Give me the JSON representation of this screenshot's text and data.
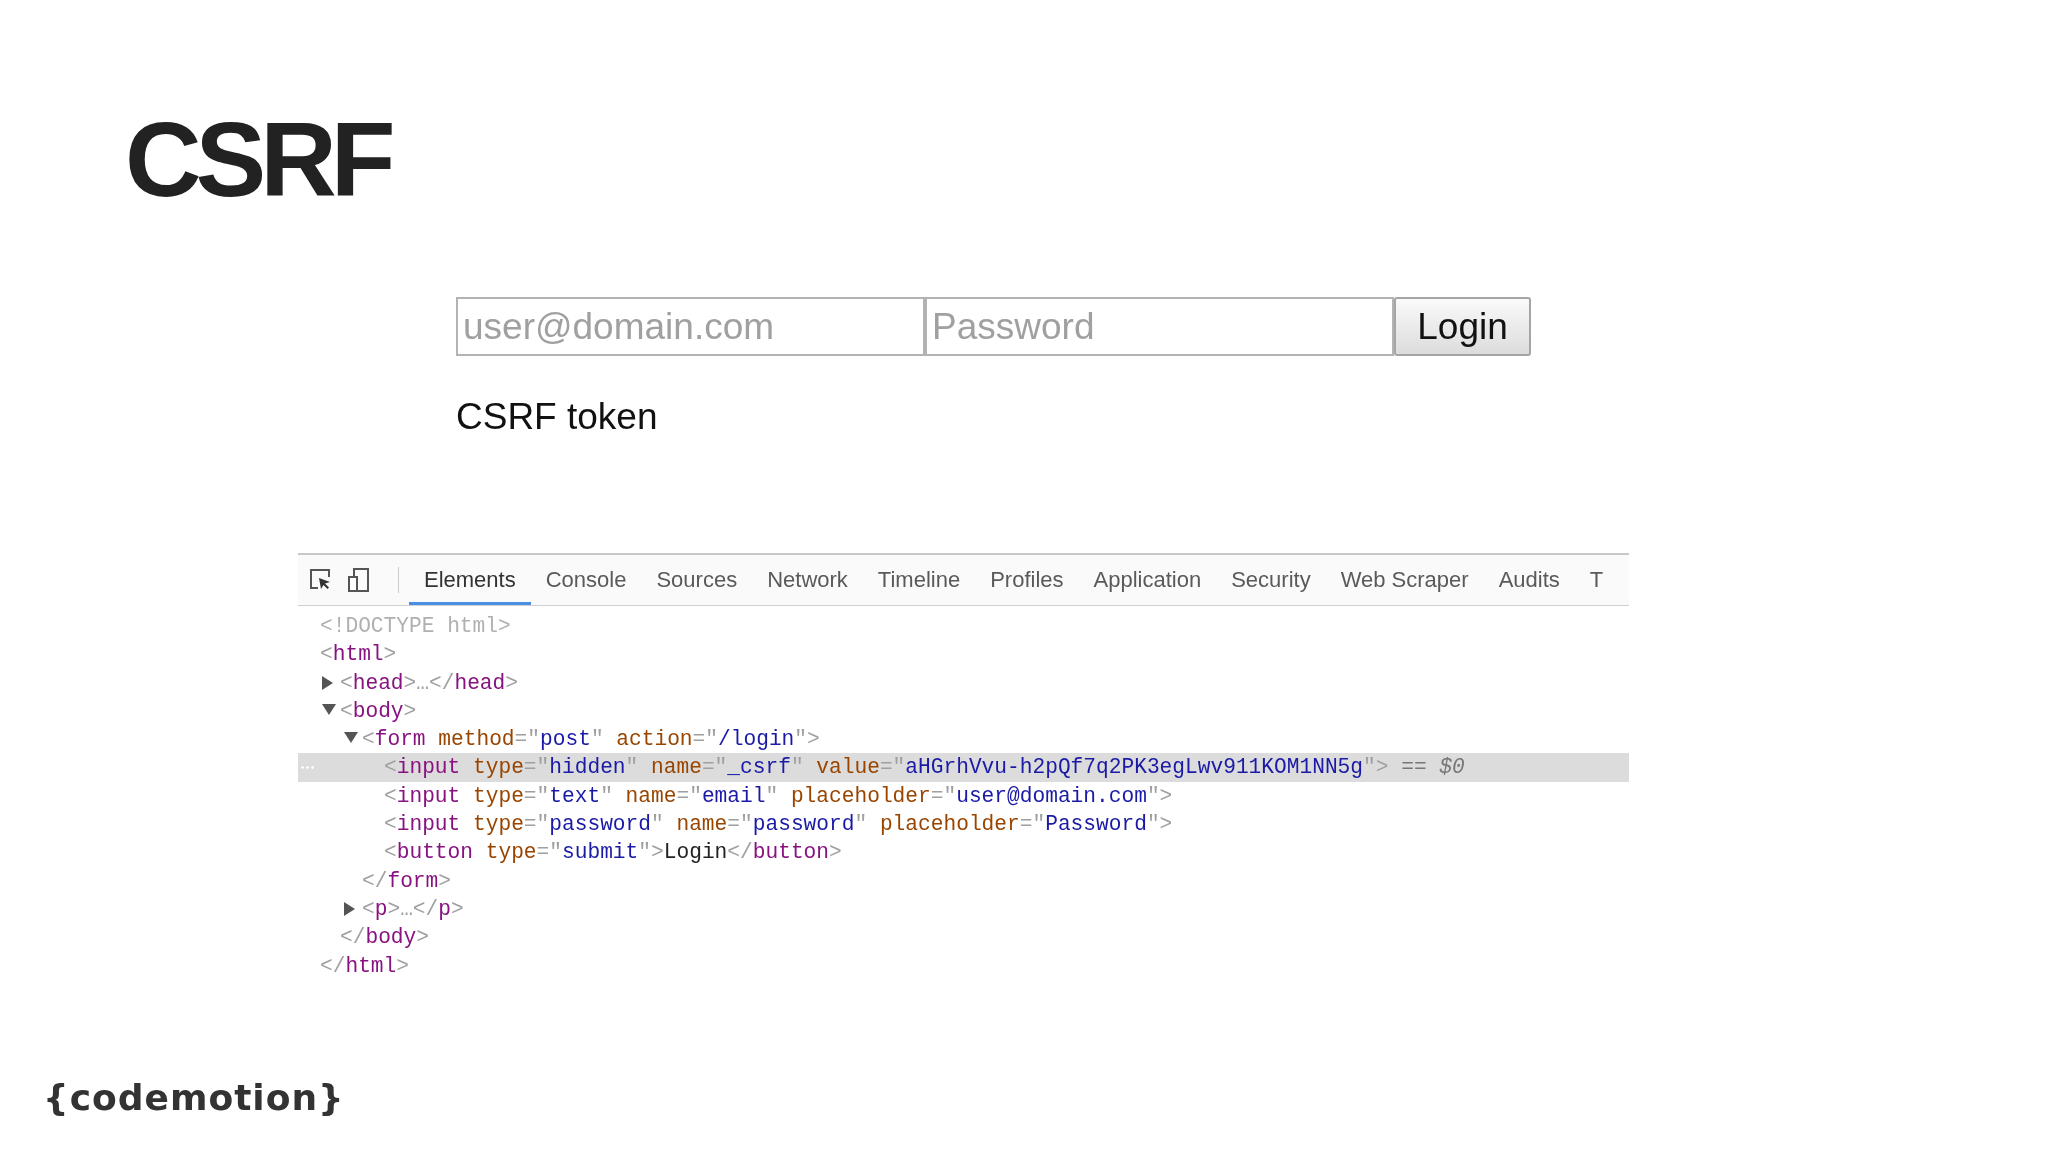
{
  "slide": {
    "title": "CSRF",
    "logo": "{codemotion}"
  },
  "login_form": {
    "email": {
      "placeholder": "user@domain.com"
    },
    "password": {
      "placeholder": "Password"
    },
    "button": "Login"
  },
  "caption": "CSRF token",
  "devtools": {
    "tabs": [
      {
        "label": "Elements",
        "selected": true
      },
      {
        "label": "Console",
        "selected": false
      },
      {
        "label": "Sources",
        "selected": false
      },
      {
        "label": "Network",
        "selected": false
      },
      {
        "label": "Timeline",
        "selected": false
      },
      {
        "label": "Profiles",
        "selected": false
      },
      {
        "label": "Application",
        "selected": false
      },
      {
        "label": "Security",
        "selected": false
      },
      {
        "label": "Web Scraper",
        "selected": false
      },
      {
        "label": "Audits",
        "selected": false
      },
      {
        "label": "T",
        "selected": false
      }
    ],
    "dom_tree": [
      {
        "selected": false,
        "tokens": [
          {
            "kind": "doctype",
            "text": "<!DOCTYPE html>"
          }
        ]
      },
      {
        "selected": false,
        "tokens": [
          {
            "kind": "punct",
            "text": "<"
          },
          {
            "kind": "tag",
            "text": "html"
          },
          {
            "kind": "punct",
            "text": ">"
          }
        ],
        "close": [
          {
            "kind": "punct",
            "text": "</"
          },
          {
            "kind": "tag",
            "text": "html"
          },
          {
            "kind": "punct",
            "text": ">"
          }
        ],
        "children": [
          {
            "selected": false,
            "expanded": false,
            "tokens": [
              {
                "kind": "punct",
                "text": "<"
              },
              {
                "kind": "tag",
                "text": "head"
              },
              {
                "kind": "punct",
                "text": ">…</"
              },
              {
                "kind": "tag",
                "text": "head"
              },
              {
                "kind": "punct",
                "text": ">"
              }
            ]
          },
          {
            "selected": false,
            "expanded": true,
            "tokens": [
              {
                "kind": "punct",
                "text": "<"
              },
              {
                "kind": "tag",
                "text": "body"
              },
              {
                "kind": "punct",
                "text": ">"
              }
            ],
            "close": [
              {
                "kind": "punct",
                "text": "</"
              },
              {
                "kind": "tag",
                "text": "body"
              },
              {
                "kind": "punct",
                "text": ">"
              }
            ],
            "children": [
              {
                "selected": false,
                "expanded": true,
                "tokens": [
                  {
                    "kind": "punct",
                    "text": "<"
                  },
                  {
                    "kind": "tag",
                    "text": "form"
                  },
                  {
                    "kind": "attr",
                    "text": "method"
                  },
                  {
                    "kind": "punct",
                    "text": "=\""
                  },
                  {
                    "kind": "value",
                    "text": "post"
                  },
                  {
                    "kind": "punct",
                    "text": "\""
                  },
                  {
                    "kind": "attr",
                    "text": "action"
                  },
                  {
                    "kind": "punct",
                    "text": "=\""
                  },
                  {
                    "kind": "value",
                    "text": "/login"
                  },
                  {
                    "kind": "punct",
                    "text": "\">"
                  }
                ],
                "close": [
                  {
                    "kind": "punct",
                    "text": "</"
                  },
                  {
                    "kind": "tag",
                    "text": "form"
                  },
                  {
                    "kind": "punct",
                    "text": ">"
                  }
                ],
                "children": [
                  {
                    "selected": true,
                    "tokens": [
                      {
                        "kind": "punct",
                        "text": "<"
                      },
                      {
                        "kind": "tag",
                        "text": "input"
                      },
                      {
                        "kind": "attr",
                        "text": "type"
                      },
                      {
                        "kind": "punct",
                        "text": "=\""
                      },
                      {
                        "kind": "value",
                        "text": "hidden"
                      },
                      {
                        "kind": "punct",
                        "text": "\""
                      },
                      {
                        "kind": "attr",
                        "text": "name"
                      },
                      {
                        "kind": "punct",
                        "text": "=\""
                      },
                      {
                        "kind": "value",
                        "text": "_csrf"
                      },
                      {
                        "kind": "punct",
                        "text": "\""
                      },
                      {
                        "kind": "attr",
                        "text": "value"
                      },
                      {
                        "kind": "punct",
                        "text": "=\""
                      },
                      {
                        "kind": "value",
                        "text": "aHGrhVvu-h2pQf7q2PK3egLwv911KOM1NN5g"
                      },
                      {
                        "kind": "punct",
                        "text": "\">"
                      },
                      {
                        "kind": "note",
                        "text": "== $0"
                      }
                    ]
                  },
                  {
                    "selected": false,
                    "tokens": [
                      {
                        "kind": "punct",
                        "text": "<"
                      },
                      {
                        "kind": "tag",
                        "text": "input"
                      },
                      {
                        "kind": "attr",
                        "text": "type"
                      },
                      {
                        "kind": "punct",
                        "text": "=\""
                      },
                      {
                        "kind": "value",
                        "text": "text"
                      },
                      {
                        "kind": "punct",
                        "text": "\""
                      },
                      {
                        "kind": "attr",
                        "text": "name"
                      },
                      {
                        "kind": "punct",
                        "text": "=\""
                      },
                      {
                        "kind": "value",
                        "text": "email"
                      },
                      {
                        "kind": "punct",
                        "text": "\""
                      },
                      {
                        "kind": "attr",
                        "text": "placeholder"
                      },
                      {
                        "kind": "punct",
                        "text": "=\""
                      },
                      {
                        "kind": "value",
                        "text": "user@domain.com"
                      },
                      {
                        "kind": "punct",
                        "text": "\">"
                      }
                    ]
                  },
                  {
                    "selected": false,
                    "tokens": [
                      {
                        "kind": "punct",
                        "text": "<"
                      },
                      {
                        "kind": "tag",
                        "text": "input"
                      },
                      {
                        "kind": "attr",
                        "text": "type"
                      },
                      {
                        "kind": "punct",
                        "text": "=\""
                      },
                      {
                        "kind": "value",
                        "text": "password"
                      },
                      {
                        "kind": "punct",
                        "text": "\""
                      },
                      {
                        "kind": "attr",
                        "text": "name"
                      },
                      {
                        "kind": "punct",
                        "text": "=\""
                      },
                      {
                        "kind": "value",
                        "text": "password"
                      },
                      {
                        "kind": "punct",
                        "text": "\""
                      },
                      {
                        "kind": "attr",
                        "text": "placeholder"
                      },
                      {
                        "kind": "punct",
                        "text": "=\""
                      },
                      {
                        "kind": "value",
                        "text": "Password"
                      },
                      {
                        "kind": "punct",
                        "text": "\">"
                      }
                    ]
                  },
                  {
                    "selected": false,
                    "tokens": [
                      {
                        "kind": "punct",
                        "text": "<"
                      },
                      {
                        "kind": "tag",
                        "text": "button"
                      },
                      {
                        "kind": "attr",
                        "text": "type"
                      },
                      {
                        "kind": "punct",
                        "text": "=\""
                      },
                      {
                        "kind": "value",
                        "text": "submit"
                      },
                      {
                        "kind": "punct",
                        "text": "\">"
                      },
                      {
                        "kind": "content",
                        "text": "Login"
                      },
                      {
                        "kind": "punct",
                        "text": "</"
                      },
                      {
                        "kind": "tag",
                        "text": "button"
                      },
                      {
                        "kind": "punct",
                        "text": ">"
                      }
                    ]
                  }
                ]
              },
              {
                "selected": false,
                "expanded": false,
                "tokens": [
                  {
                    "kind": "punct",
                    "text": "<"
                  },
                  {
                    "kind": "tag",
                    "text": "p"
                  },
                  {
                    "kind": "punct",
                    "text": ">…</"
                  },
                  {
                    "kind": "tag",
                    "text": "p"
                  },
                  {
                    "kind": "punct",
                    "text": ">"
                  }
                ]
              }
            ]
          }
        ]
      }
    ]
  }
}
